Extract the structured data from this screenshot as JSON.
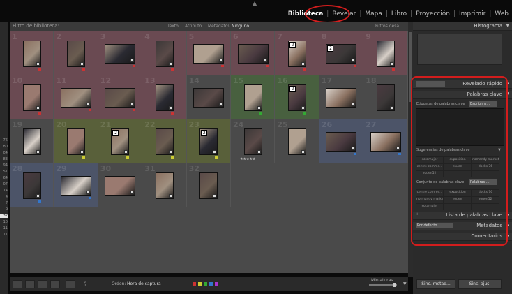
{
  "modules": {
    "items": [
      "Biblioteca",
      "Revelar",
      "Mapa",
      "Libro",
      "Proyección",
      "Imprimir",
      "Web"
    ],
    "active": "Biblioteca",
    "separator": "|"
  },
  "filter_bar": {
    "label": "Filtro de biblioteca:",
    "options": [
      "Texto",
      "Atributo",
      "Metadatos",
      "Ninguno"
    ],
    "active": "Ninguno",
    "preset": "Filtros desa..."
  },
  "grid": {
    "cells": [
      {
        "n": "1",
        "color": "#6a4a52",
        "flag": "#c33"
      },
      {
        "n": "2",
        "color": "#6a4a52",
        "flag": "#c33"
      },
      {
        "n": "3",
        "color": "#6a4a52",
        "flag": "#c33"
      },
      {
        "n": "4",
        "color": "#6a4a52",
        "flag": "#c33"
      },
      {
        "n": "5",
        "color": "#6a4a52",
        "flag": "#c33"
      },
      {
        "n": "6",
        "color": "#6a4a52",
        "flag": "#c33"
      },
      {
        "n": "7",
        "color": "#6a4a52",
        "flag": "#c33"
      },
      {
        "n": "8",
        "color": "#6a4a52",
        "flag": "#c33"
      },
      {
        "n": "9",
        "color": "#6a4a52",
        "flag": "#c33"
      },
      {
        "n": "10",
        "color": "#6a4a52",
        "flag": "#c33"
      },
      {
        "n": "11",
        "color": "#6a4a52",
        "flag": "#c33"
      },
      {
        "n": "12",
        "color": "#6a4a52",
        "flag": "#c33"
      },
      {
        "n": "13",
        "color": "#6a4a52",
        "flag": "#c33"
      },
      {
        "n": "14",
        "color": "#4a4a4a",
        "flag": ""
      },
      {
        "n": "15",
        "color": "#48603f",
        "flag": "#3a3"
      },
      {
        "n": "16",
        "color": "#48603f",
        "flag": "#3a3"
      },
      {
        "n": "17",
        "color": "#4a4a4a",
        "flag": ""
      },
      {
        "n": "18",
        "color": "#4a4a4a",
        "flag": ""
      },
      {
        "n": "19",
        "color": "#4a4a4a",
        "flag": ""
      },
      {
        "n": "20",
        "color": "#59603a",
        "flag": "#cc3"
      },
      {
        "n": "21",
        "color": "#59603a",
        "flag": "#cc3"
      },
      {
        "n": "22",
        "color": "#59603a",
        "flag": "#cc3"
      },
      {
        "n": "23",
        "color": "#59603a",
        "flag": "#cc3"
      },
      {
        "n": "24",
        "color": "#4a4a4a",
        "flag": ""
      },
      {
        "n": "25",
        "color": "#4a4a4a",
        "flag": ""
      },
      {
        "n": "26",
        "color": "#4c5468",
        "flag": "#37c"
      },
      {
        "n": "27",
        "color": "#4c5468",
        "flag": "#37c"
      },
      {
        "n": "28",
        "color": "#4c5468",
        "flag": "#37c"
      },
      {
        "n": "29",
        "color": "#4c5468",
        "flag": "#37c"
      },
      {
        "n": "30",
        "color": "#4a4a4a",
        "flag": ""
      },
      {
        "n": "31",
        "color": "#4a4a4a",
        "flag": ""
      },
      {
        "n": "32",
        "color": "#4a4a4a",
        "flag": ""
      }
    ],
    "rating_stars": "★★★★★"
  },
  "left_numbers": [
    "76",
    "80",
    "04",
    "83",
    "94",
    "51",
    "64",
    "07",
    "74",
    "4",
    "7",
    "9",
    "32",
    "10",
    "11",
    "11"
  ],
  "left_selected": "32",
  "right_panel": {
    "histogram": "Histograma",
    "quick_develop": "Revelado rápido",
    "keywords": "Palabras clave",
    "keyword_tags_label": "Etiquetas de palabras clave",
    "keyword_tags_mode": "Escribir p...",
    "suggestions_label": "Sugerencias de palabras clave",
    "suggestions": [
      "sotamujer",
      "exposition",
      "nomandy market",
      "centre comme...",
      "rouen",
      "docks 76",
      "rouen52",
      "",
      ""
    ],
    "keyword_set_label": "Conjunto de palabras clave",
    "keyword_set_value": "Palabras ...",
    "keyword_set": [
      "centre comme...",
      "exposition",
      "docks 76",
      "normandy market",
      "rouen",
      "rouen52",
      "sotamujer",
      "",
      ""
    ],
    "keyword_list": "Lista de palabras clave",
    "metadata": "Metadatos",
    "metadata_preset": "Por defecto",
    "comments": "Comentarios",
    "sync_metadata": "Sinc. metad...",
    "sync_settings": "Sinc. ajus."
  },
  "toolbar": {
    "sort_label": "Orden:",
    "sort_value": "Hora de captura",
    "thumbnails_label": "Miniaturas",
    "label_colors": [
      "#c33",
      "#cc3",
      "#3a3",
      "#37c",
      "#a3c"
    ]
  },
  "colors": {
    "annotation": "#d21d1d"
  }
}
